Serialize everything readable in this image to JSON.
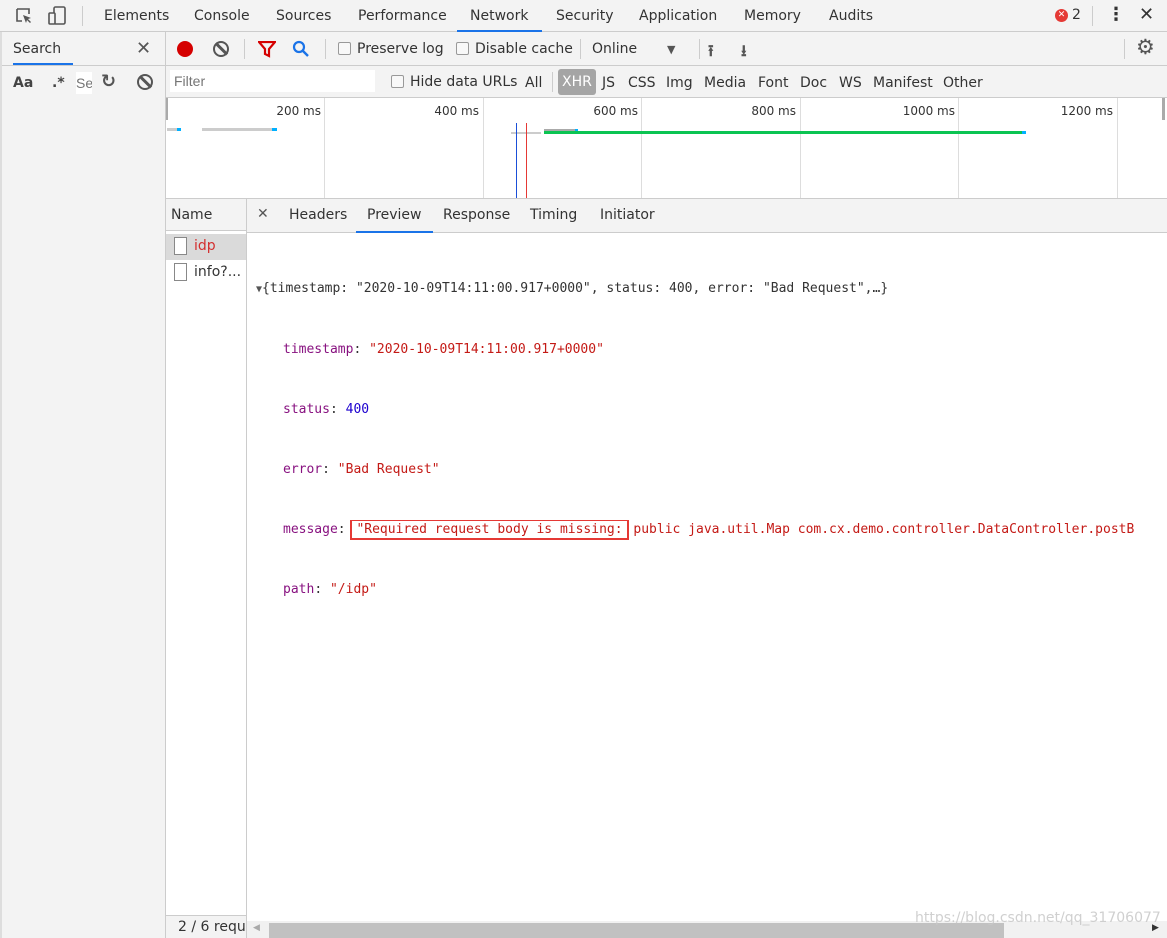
{
  "tabs": [
    "Elements",
    "Console",
    "Sources",
    "Performance",
    "Network",
    "Security",
    "Application",
    "Memory",
    "Audits"
  ],
  "active_tab": "Network",
  "error_count": "2",
  "search": {
    "title": "Search",
    "aa": "Aa",
    "regex": ".*",
    "input_placeholder": "Se"
  },
  "toolbar": {
    "preserve_log": "Preserve log",
    "disable_cache": "Disable cache",
    "throttle": "Online"
  },
  "filter": {
    "placeholder": "Filter",
    "hide_data_urls": "Hide data URLs",
    "types": [
      "All",
      "XHR",
      "JS",
      "CSS",
      "Img",
      "Media",
      "Font",
      "Doc",
      "WS",
      "Manifest",
      "Other"
    ],
    "active_type": "XHR"
  },
  "timeline": {
    "ticks": [
      "200 ms",
      "400 ms",
      "600 ms",
      "800 ms",
      "1000 ms",
      "1200 ms"
    ]
  },
  "requests": {
    "header": "Name",
    "items": [
      {
        "name": "idp",
        "error": true
      },
      {
        "name": "info?...",
        "error": false
      }
    ],
    "status": "2 / 6 requ"
  },
  "detail_tabs": [
    "Headers",
    "Preview",
    "Response",
    "Timing",
    "Initiator"
  ],
  "active_detail_tab": "Preview",
  "preview": {
    "summary": "{timestamp: \"2020-10-09T14:11:00.917+0000\", status: 400, error: \"Bad Request\",…}",
    "fields": [
      {
        "key": "timestamp",
        "value": "\"2020-10-09T14:11:00.917+0000\"",
        "type": "string"
      },
      {
        "key": "status",
        "value": "400",
        "type": "number"
      },
      {
        "key": "error",
        "value": "\"Bad Request\"",
        "type": "string"
      }
    ],
    "message_key": "message",
    "message_highlight": "\"Required request body is missing:",
    "message_rest": " public java.util.Map com.cx.demo.controller.DataController.postB",
    "path_key": "path",
    "path_value": "\"/idp\""
  },
  "watermark": "https://blog.csdn.net/qq_31706077",
  "colors": {
    "accent": "#1a73e8",
    "record": "#d50000",
    "highlight_box": "#e53935",
    "green_bar": "#0bc452"
  }
}
